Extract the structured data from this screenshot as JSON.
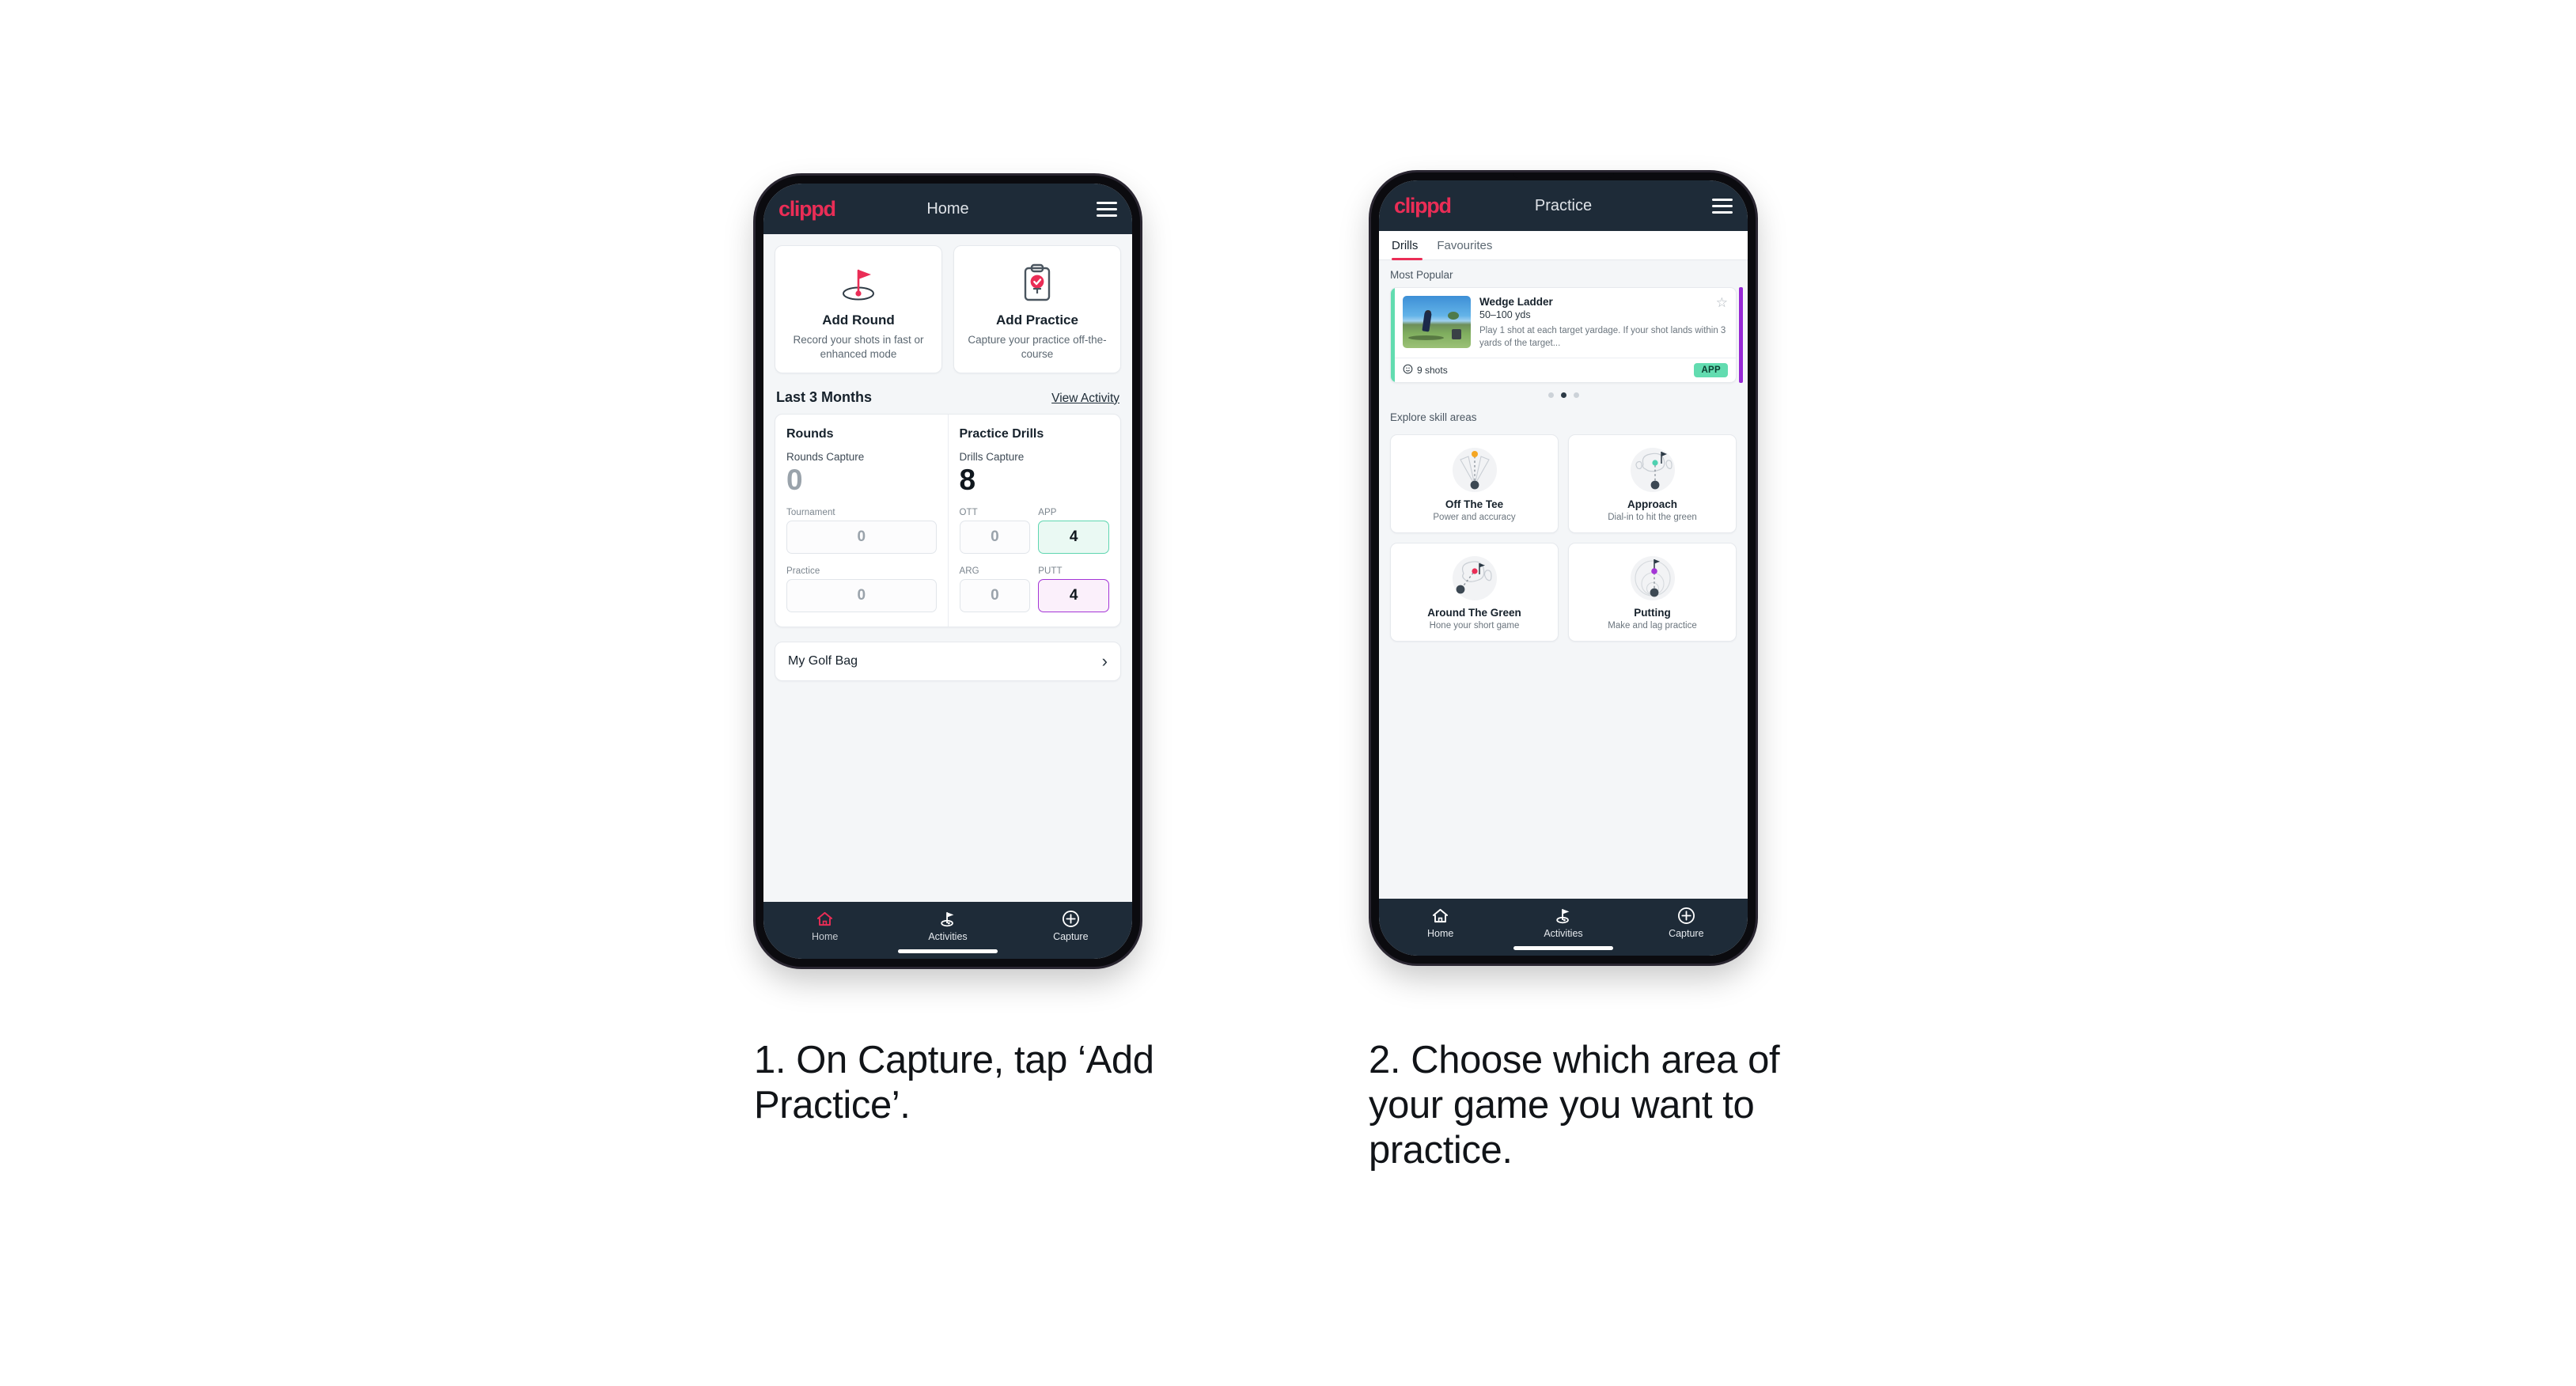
{
  "brand": {
    "logo_text": "clippd",
    "accent_pink": "#ea2d56",
    "nav_dark": "#1e2b38"
  },
  "phone1": {
    "appbar": {
      "title": "Home",
      "menu_icon": "hamburger-icon"
    },
    "actions": [
      {
        "icon": "golf-flag-hole-icon",
        "title": "Add Round",
        "subtitle": "Record your shots in fast or enhanced mode"
      },
      {
        "icon": "clipboard-check-icon",
        "title": "Add Practice",
        "subtitle": "Capture your practice off-the-course"
      }
    ],
    "section": {
      "title": "Last 3 Months",
      "link": "View Activity"
    },
    "rounds": {
      "title": "Rounds",
      "capture_label": "Rounds Capture",
      "capture_value": "0",
      "stats": [
        {
          "label": "Tournament",
          "value": "0",
          "highlight": "none"
        },
        {
          "label": "Practice",
          "value": "0",
          "highlight": "none"
        }
      ]
    },
    "drills": {
      "title": "Practice Drills",
      "capture_label": "Drills Capture",
      "capture_value": "8",
      "stats": [
        {
          "label": "OTT",
          "value": "0",
          "highlight": "none"
        },
        {
          "label": "APP",
          "value": "4",
          "highlight": "green"
        },
        {
          "label": "ARG",
          "value": "0",
          "highlight": "none"
        },
        {
          "label": "PUTT",
          "value": "4",
          "highlight": "purple"
        }
      ]
    },
    "golf_bag": {
      "label": "My Golf Bag",
      "chevron": "chevron-right-icon"
    },
    "bottom_nav": [
      {
        "icon": "home-icon",
        "label": "Home",
        "active": true
      },
      {
        "icon": "golf-flag-icon",
        "label": "Activities",
        "active": false
      },
      {
        "icon": "plus-circle-icon",
        "label": "Capture",
        "active": false
      }
    ]
  },
  "phone2": {
    "appbar": {
      "title": "Practice",
      "menu_icon": "hamburger-icon"
    },
    "tabs": [
      {
        "label": "Drills",
        "active": true
      },
      {
        "label": "Favourites",
        "active": false
      }
    ],
    "most_popular_label": "Most Popular",
    "drill_card": {
      "title": "Wedge Ladder",
      "yardage": "50–100 yds",
      "description": "Play 1 shot at each target yardage. If your shot lands within 3 yards of the target...",
      "shots": "9 shots",
      "shots_icon": "clock-icon",
      "badge": "APP",
      "star_icon": "star-outline-icon",
      "accent_color": "#62dcb0",
      "next_card_accent": "#9627d4"
    },
    "carousel_dots": {
      "count": 3,
      "active_index": 1
    },
    "explore_label": "Explore skill areas",
    "skill_areas": [
      {
        "icon": "tee-shot-fan-icon",
        "title": "Off The Tee",
        "subtitle": "Power and accuracy",
        "dot_color": "#f5a623"
      },
      {
        "icon": "approach-green-icon",
        "title": "Approach",
        "subtitle": "Dial-in to hit the green",
        "dot_color": "#4fd1b0"
      },
      {
        "icon": "short-game-green-icon",
        "title": "Around The Green",
        "subtitle": "Hone your short game",
        "dot_color": "#ea2d56"
      },
      {
        "icon": "putting-rings-icon",
        "title": "Putting",
        "subtitle": "Make and lag practice",
        "dot_color": "#a435d6"
      }
    ],
    "bottom_nav": [
      {
        "icon": "home-icon",
        "label": "Home",
        "active": false
      },
      {
        "icon": "golf-flag-icon",
        "label": "Activities",
        "active": true
      },
      {
        "icon": "plus-circle-icon",
        "label": "Capture",
        "active": false
      }
    ]
  },
  "captions": {
    "step1": "1. On Capture, tap ‘Add Practice’.",
    "step2": "2. Choose which area of your game you want to practice."
  }
}
